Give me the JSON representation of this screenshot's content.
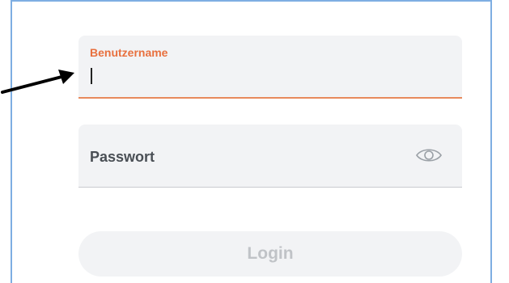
{
  "form": {
    "username": {
      "label": "Benutzername",
      "value": "",
      "focused": true
    },
    "password": {
      "placeholder": "Passwort",
      "visibility_icon": "eye-icon"
    },
    "login_button": {
      "label": "Login",
      "enabled": false
    }
  },
  "annotation": {
    "pointer_icon": "arrow-icon"
  },
  "colors": {
    "frame_border": "#7eaee2",
    "accent": "#e8703e",
    "field_background": "#f2f3f5",
    "disabled_text": "#c0c3c7"
  }
}
